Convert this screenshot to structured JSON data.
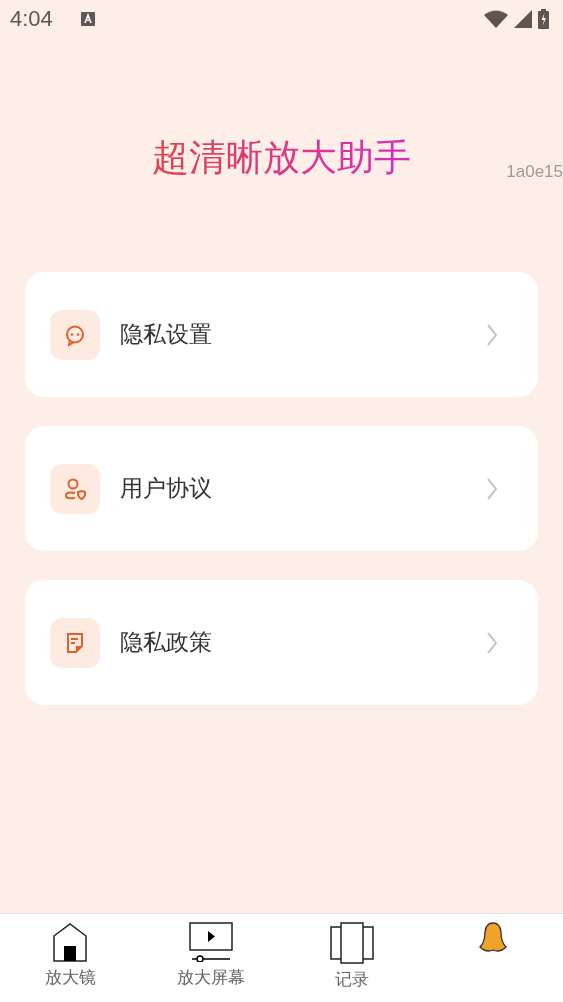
{
  "status_bar": {
    "time": "4:04"
  },
  "title": "超清晰放大助手",
  "version": "1a0e15",
  "menu": [
    {
      "kind": "chat",
      "label": "隐私设置"
    },
    {
      "kind": "user",
      "label": "用户协议"
    },
    {
      "kind": "doc",
      "label": "隐私政策"
    }
  ],
  "tabs": [
    {
      "kind": "home",
      "label": "放大镜",
      "selected": false
    },
    {
      "kind": "screen",
      "label": "放大屏幕",
      "selected": false
    },
    {
      "kind": "pages",
      "label": "记录",
      "selected": false
    },
    {
      "kind": "bell",
      "selected": true
    }
  ]
}
